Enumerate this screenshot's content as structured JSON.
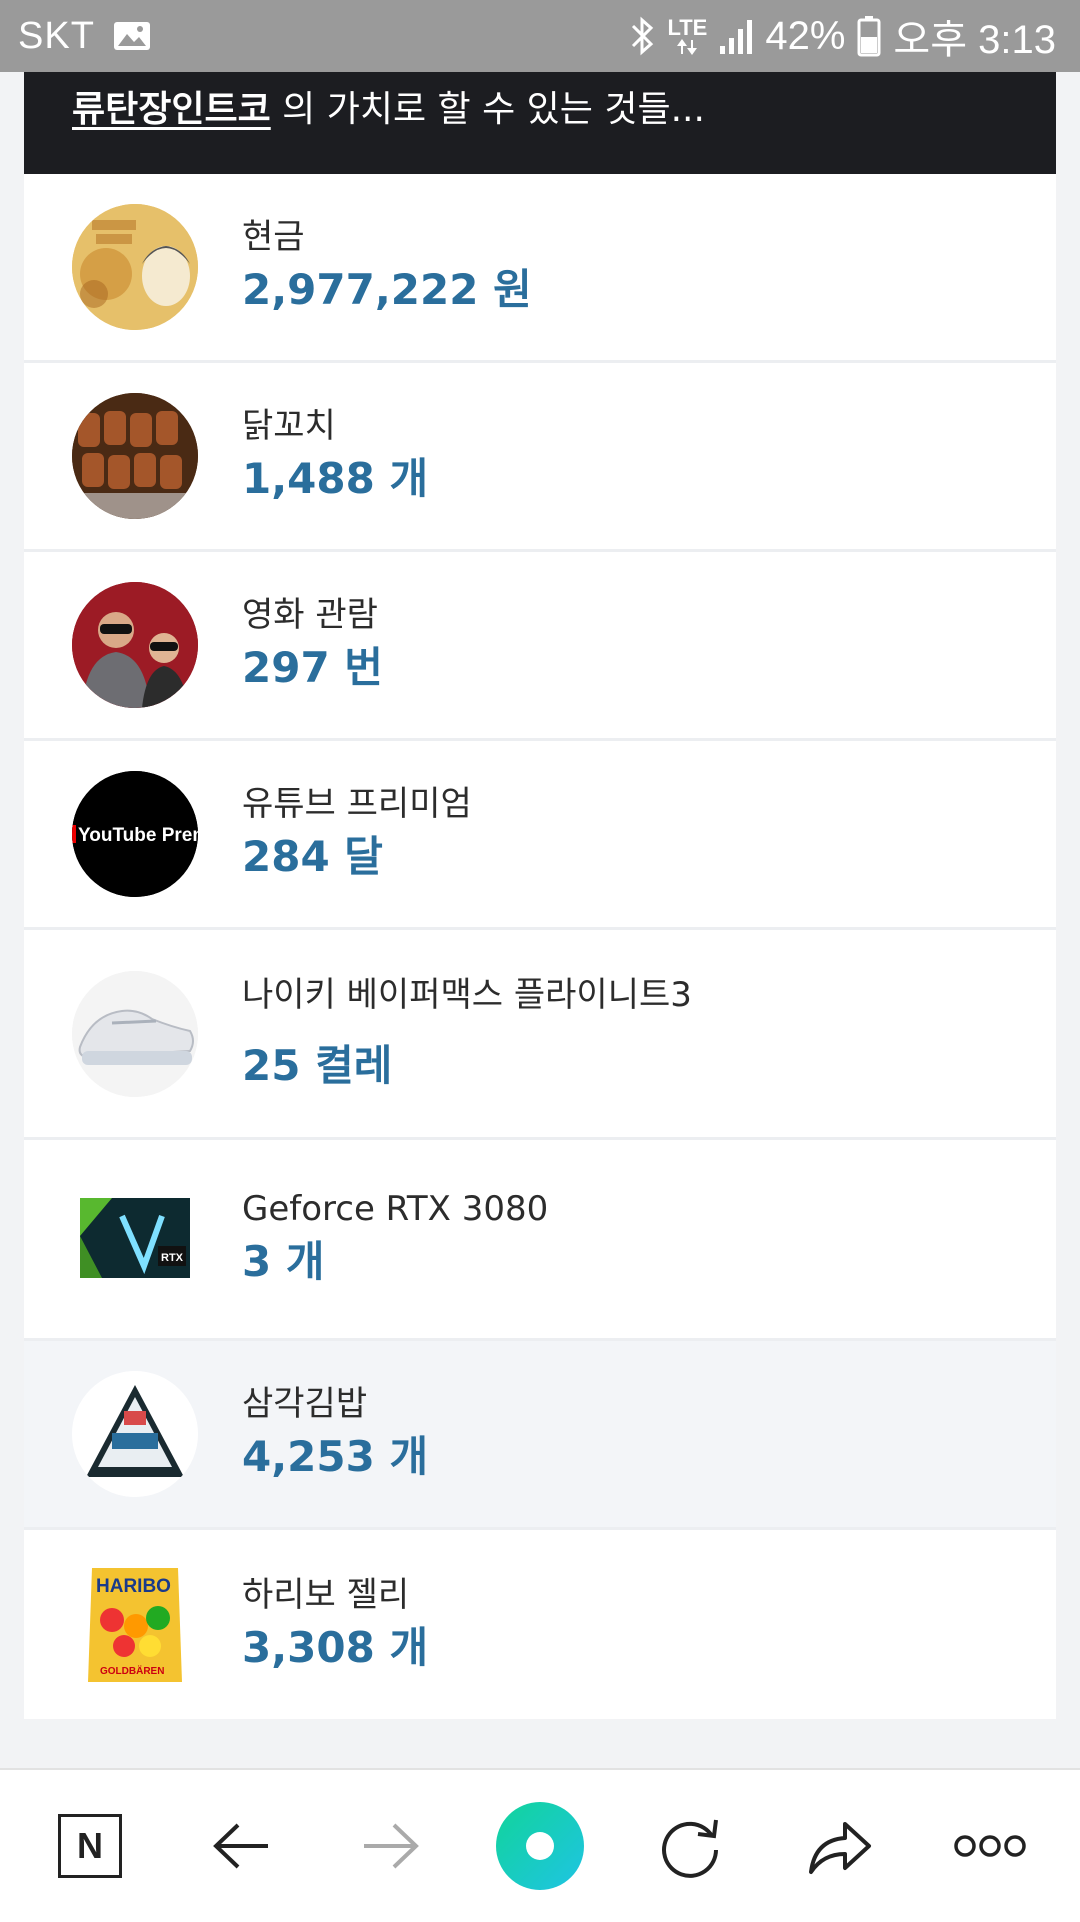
{
  "status_bar": {
    "carrier": "SKT",
    "network": "LTE",
    "battery": "42%",
    "time": "오후 3:13",
    "icons": [
      "gallery-icon",
      "bluetooth-icon",
      "signal-icon",
      "battery-icon"
    ]
  },
  "header": {
    "link": "류탄장인트코",
    "text": " 의 가치로 할 수 있는 것들..."
  },
  "items": [
    {
      "name": "현금",
      "value": "2,977,222 원",
      "icon": "banknote"
    },
    {
      "name": "닭꼬치",
      "value": "1,488 개",
      "icon": "chicken-skewers"
    },
    {
      "name": "영화 관람",
      "value": "297 번",
      "icon": "movie-audience"
    },
    {
      "name": "유튜브 프리미엄",
      "value": "284 달",
      "icon": "youtube-premium",
      "logo_text": "YouTube Premium"
    },
    {
      "name": "나이키 베이퍼맥스 플라이니트3",
      "value": "25 켤레",
      "icon": "sneaker"
    },
    {
      "name": "Geforce RTX 3080",
      "value": "3 개",
      "icon": "graphics-card",
      "logo_text": "RTX"
    },
    {
      "name": "삼각김밥",
      "value": "4,253 개",
      "icon": "triangle-kimbap"
    },
    {
      "name": "하리보 젤리",
      "value": "3,308 개",
      "icon": "haribo-bag",
      "logo_text": "HARIBO",
      "sub_text": "GOLDBÄREN"
    }
  ],
  "colors": {
    "value": "#2a6e9c",
    "header_bg": "#1c1d21",
    "home_button": "#19d1b5"
  },
  "bottom_nav": {
    "home_letter": "N",
    "icons": [
      "naver-home-icon",
      "back-icon",
      "forward-icon",
      "green-dot-icon",
      "refresh-icon",
      "share-icon",
      "more-icon"
    ]
  }
}
